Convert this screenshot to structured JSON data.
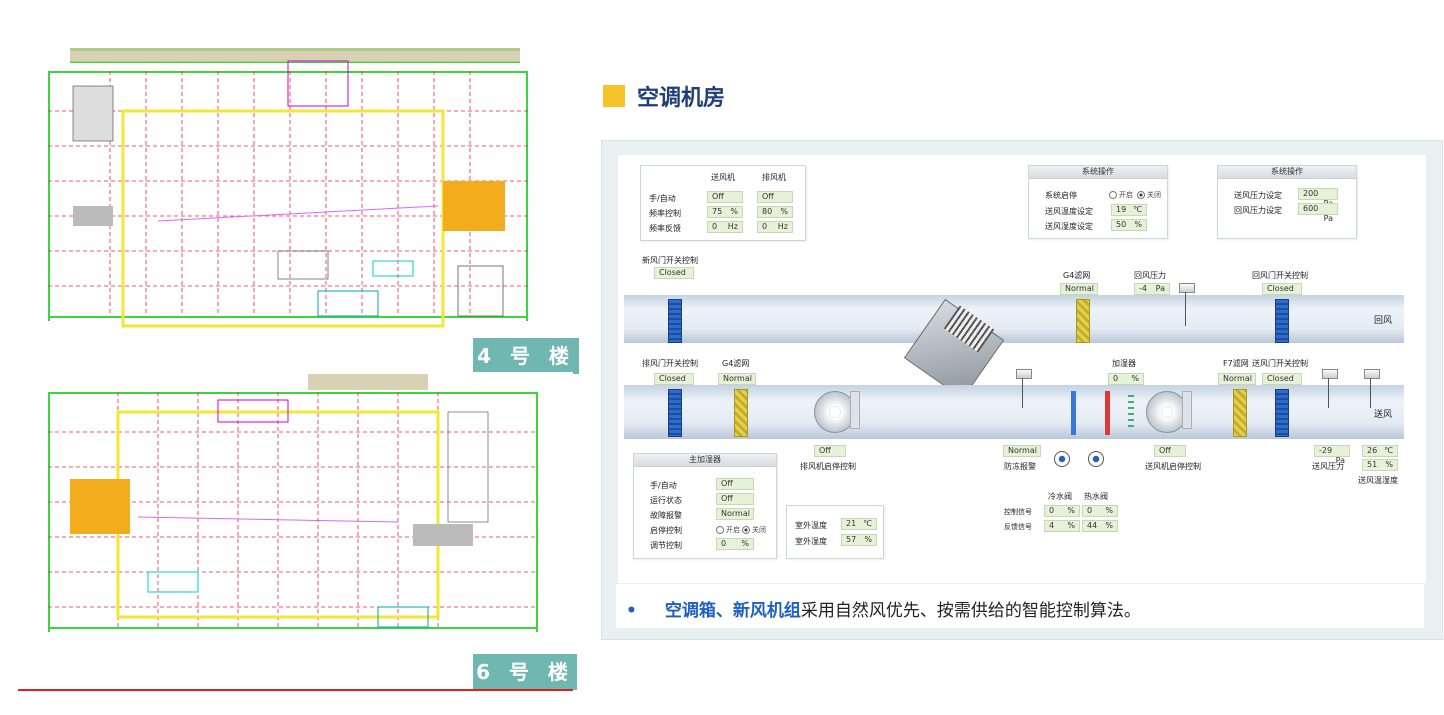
{
  "buildings": [
    {
      "label": "4 号 楼"
    },
    {
      "label": "6 号 楼"
    }
  ],
  "section": {
    "title": "空调机房"
  },
  "colors": {
    "accent_square": "#f6c328",
    "title": "#1f3f76",
    "label_bg": "#6fb7b0",
    "value_bg": "#e6f2d8",
    "highlight": "#2060c0",
    "plan_highlight": "#f3ad1c"
  },
  "hmi": {
    "fan_panel": {
      "col_supply": "送风机",
      "col_exhaust": "排风机",
      "rows": [
        {
          "label": "手/自动",
          "supply": "Off",
          "exhaust": "Off"
        },
        {
          "label": "频率控制",
          "supply": "75",
          "supply_unit": "%",
          "exhaust": "80",
          "exhaust_unit": "%"
        },
        {
          "label": "频率反馈",
          "supply": "0",
          "supply_unit": "Hz",
          "exhaust": "0",
          "exhaust_unit": "Hz"
        }
      ]
    },
    "sys_op1": {
      "title": "系统操作",
      "start_stop_label": "系统启停",
      "opt_on": "开启",
      "opt_off": "关闭",
      "temp_label": "送风温度设定",
      "temp_val": "19",
      "temp_unit": "℃",
      "hum_label": "送风湿度设定",
      "hum_val": "50",
      "hum_unit": "%"
    },
    "sys_op2": {
      "title": "系统操作",
      "sp_label": "送风压力设定",
      "sp_val": "200",
      "sp_unit": "Pa",
      "rp_label": "回风压力设定",
      "rp_val": "600",
      "rp_unit": "Pa"
    },
    "fresh_damper": {
      "label": "新风门开关控制",
      "val": "Closed"
    },
    "g4_return": {
      "label": "G4滤网",
      "val": "Normal"
    },
    "return_pressure": {
      "label": "回风压力",
      "val": "-4",
      "unit": "Pa"
    },
    "return_damper": {
      "label": "回风门开关控制",
      "val": "Closed"
    },
    "return_air_word": "回风",
    "exhaust_damper": {
      "label": "排风门开关控制",
      "val": "Closed"
    },
    "g4_exhaust": {
      "label": "G4滤网",
      "val": "Normal"
    },
    "humidifier": {
      "label": "加湿器",
      "val": "0",
      "unit": "%"
    },
    "f7": {
      "label": "F7滤网",
      "val": "Normal"
    },
    "supply_damper": {
      "label": "送风门开关控制",
      "val": "Closed"
    },
    "supply_air_word": "送风",
    "exhaust_fan": {
      "val": "Off",
      "label": "排风机启停控制"
    },
    "freeze": {
      "val": "Normal",
      "label": "防冻报警"
    },
    "supply_fan": {
      "val": "Off",
      "label": "送风机启停控制"
    },
    "supply_pressure": {
      "val": "-29",
      "unit": "Pa",
      "label": "送风压力"
    },
    "supply_temp": {
      "val": "26",
      "unit": "℃"
    },
    "supply_hum": {
      "val": "51",
      "unit": "%",
      "label": "送风温湿度"
    },
    "valves": {
      "cold_label": "冷水阀",
      "hot_label": "热水阀",
      "ctrl_label": "控制信号",
      "fb_label": "反馈信号",
      "cold_ctrl": "0",
      "cold_fb": "4",
      "hot_ctrl": "0",
      "hot_fb": "44",
      "unit": "%"
    },
    "main_hum": {
      "title": "主加湿器",
      "rows": [
        {
          "label": "手/自动",
          "val": "Off"
        },
        {
          "label": "运行状态",
          "val": "Off"
        },
        {
          "label": "故障报警",
          "val": "Normal"
        }
      ],
      "startstop_label": "启停控制",
      "opt_on": "开启",
      "opt_off": "关闭",
      "adjust_label": "调节控制",
      "adjust_val": "0",
      "adjust_unit": "%"
    },
    "outdoor": {
      "temp_label": "室外温度",
      "temp_val": "21",
      "temp_unit": "℃",
      "hum_label": "室外湿度",
      "hum_val": "57",
      "hum_unit": "%"
    }
  },
  "note": {
    "bullet": "•",
    "highlight": "空调箱、新风机组",
    "text": "采用自然风优先、按需供给的智能控制算法。"
  }
}
